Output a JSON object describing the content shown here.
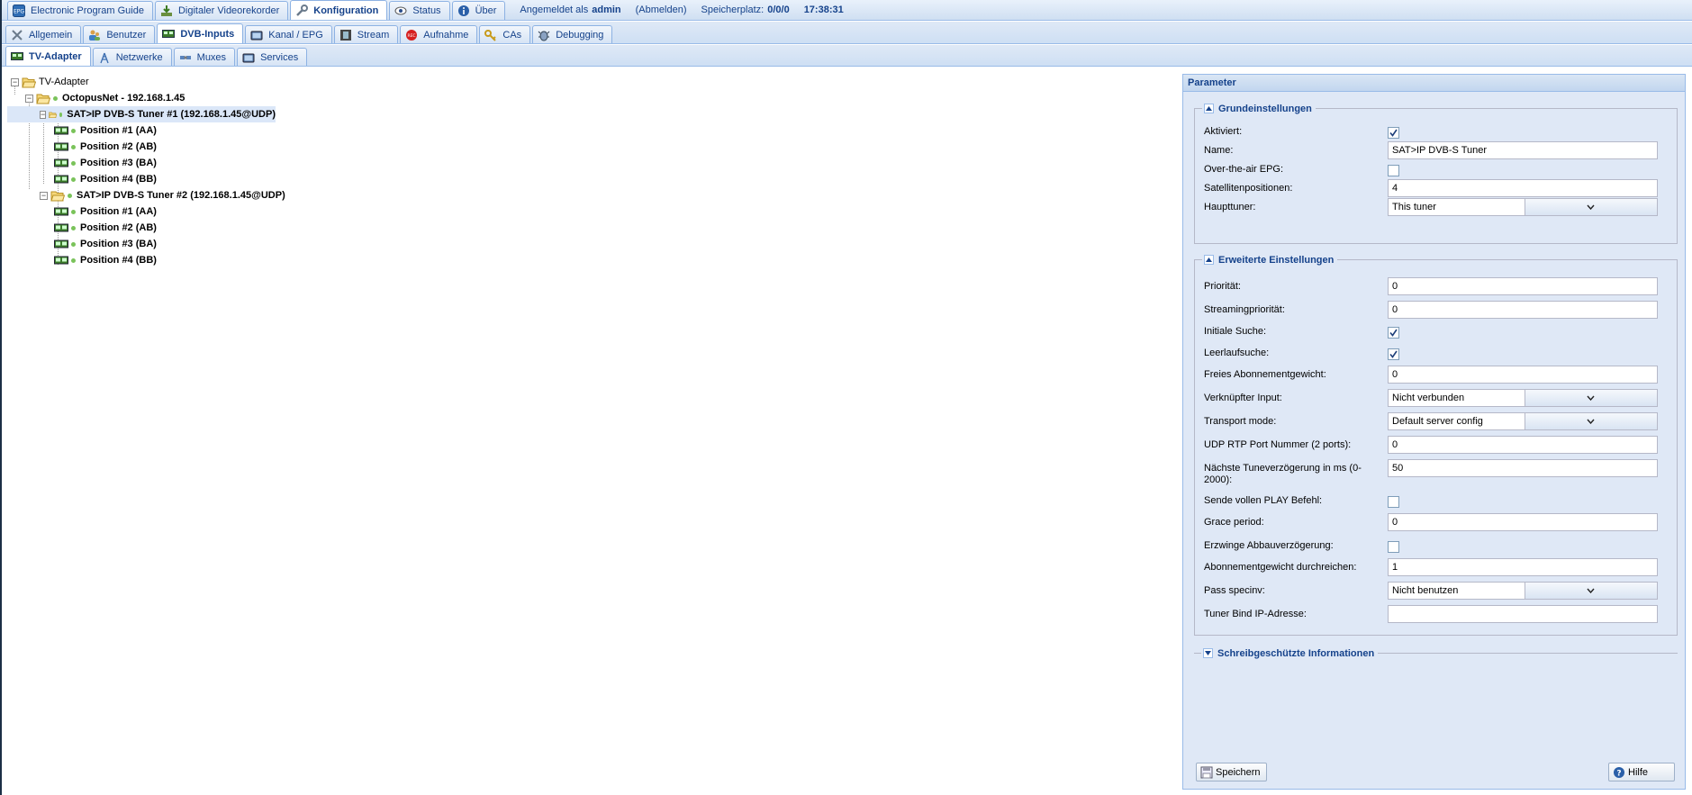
{
  "top_tabs": [
    {
      "label": "Electronic Program Guide",
      "icon": "epg-icon"
    },
    {
      "label": "Digitaler Videorekorder",
      "icon": "download-icon"
    },
    {
      "label": "Konfiguration",
      "icon": "wrench-icon",
      "active": true
    },
    {
      "label": "Status",
      "icon": "eye-icon"
    },
    {
      "label": "Über",
      "icon": "info-icon"
    }
  ],
  "session": {
    "logged_in_prefix": "Angemeldet als",
    "user": "admin",
    "logout": "(Abmelden)",
    "storage_label": "Speicherplatz:",
    "storage_value": "0/0/0",
    "time": "17:38:31"
  },
  "config_tabs": [
    {
      "label": "Allgemein",
      "icon": "tools-icon"
    },
    {
      "label": "Benutzer",
      "icon": "users-icon"
    },
    {
      "label": "DVB-Inputs",
      "icon": "tv-card-icon",
      "active": true
    },
    {
      "label": "Kanal / EPG",
      "icon": "tv-icon"
    },
    {
      "label": "Stream",
      "icon": "film-icon"
    },
    {
      "label": "Aufnahme",
      "icon": "rec-icon"
    },
    {
      "label": "CAs",
      "icon": "key-icon"
    },
    {
      "label": "Debugging",
      "icon": "bug-icon"
    }
  ],
  "dvb_tabs": [
    {
      "label": "TV-Adapter",
      "icon": "tv-card-icon",
      "active": true
    },
    {
      "label": "Netzwerke",
      "icon": "antenna-icon"
    },
    {
      "label": "Muxes",
      "icon": "satellite-icon"
    },
    {
      "label": "Services",
      "icon": "tv-icon"
    }
  ],
  "tree": {
    "root": "TV-Adapter",
    "device": "OctopusNet - 192.168.1.45",
    "tuners": [
      {
        "label": "SAT>IP DVB-S Tuner #1 (192.168.1.45@UDP)",
        "selected": true,
        "positions": [
          "Position #1 (AA)",
          "Position #2 (AB)",
          "Position #3 (BA)",
          "Position #4 (BB)"
        ]
      },
      {
        "label": "SAT>IP DVB-S Tuner #2 (192.168.1.45@UDP)",
        "selected": false,
        "positions": [
          "Position #1 (AA)",
          "Position #2 (AB)",
          "Position #3 (BA)",
          "Position #4 (BB)"
        ]
      }
    ]
  },
  "panel": {
    "title": "Parameter",
    "basic": {
      "legend": "Grundeinstellungen",
      "fields": [
        {
          "label": "Aktiviert:",
          "type": "checkbox",
          "checked": true
        },
        {
          "label": "Name:",
          "type": "text",
          "value": "SAT>IP DVB-S Tuner"
        },
        {
          "label": "Over-the-air EPG:",
          "type": "checkbox",
          "checked": false
        },
        {
          "label": "Satellitenpositionen:",
          "type": "text",
          "value": "4"
        },
        {
          "label": "Haupttuner:",
          "type": "select",
          "value": "This tuner"
        }
      ]
    },
    "advanced": {
      "legend": "Erweiterte Einstellungen",
      "fields": [
        {
          "label": "Priorität:",
          "type": "text",
          "value": "0"
        },
        {
          "label": "Streamingpriorität:",
          "type": "text",
          "value": "0"
        },
        {
          "label": "Initiale Suche:",
          "type": "checkbox",
          "checked": true
        },
        {
          "label": "Leerlaufsuche:",
          "type": "checkbox",
          "checked": true
        },
        {
          "label": "Freies Abonnementgewicht:",
          "type": "text",
          "value": "0"
        },
        {
          "label": "Verknüpfter Input:",
          "type": "select",
          "value": "Nicht verbunden"
        },
        {
          "label": "Transport mode:",
          "type": "select",
          "value": "Default server config"
        },
        {
          "label": "UDP RTP Port Nummer (2 ports):",
          "type": "text",
          "value": "0"
        },
        {
          "label": "Nächste Tuneverzögerung in ms (0-2000):",
          "type": "text",
          "value": "50"
        },
        {
          "label": "Sende vollen PLAY Befehl:",
          "type": "checkbox",
          "checked": false
        },
        {
          "label": "Grace period:",
          "type": "text",
          "value": "0"
        },
        {
          "label": "Erzwinge Abbauverzögerung:",
          "type": "checkbox",
          "checked": false
        },
        {
          "label": "Abonnementgewicht durchreichen:",
          "type": "text",
          "value": "1"
        },
        {
          "label": "Pass specinv:",
          "type": "select",
          "value": "Nicht benutzen"
        },
        {
          "label": "Tuner Bind IP-Adresse:",
          "type": "text",
          "value": ""
        }
      ]
    },
    "readonly": {
      "legend": "Schreibgeschützte Informationen"
    },
    "save_label": "Speichern",
    "help_label": "Hilfe"
  }
}
